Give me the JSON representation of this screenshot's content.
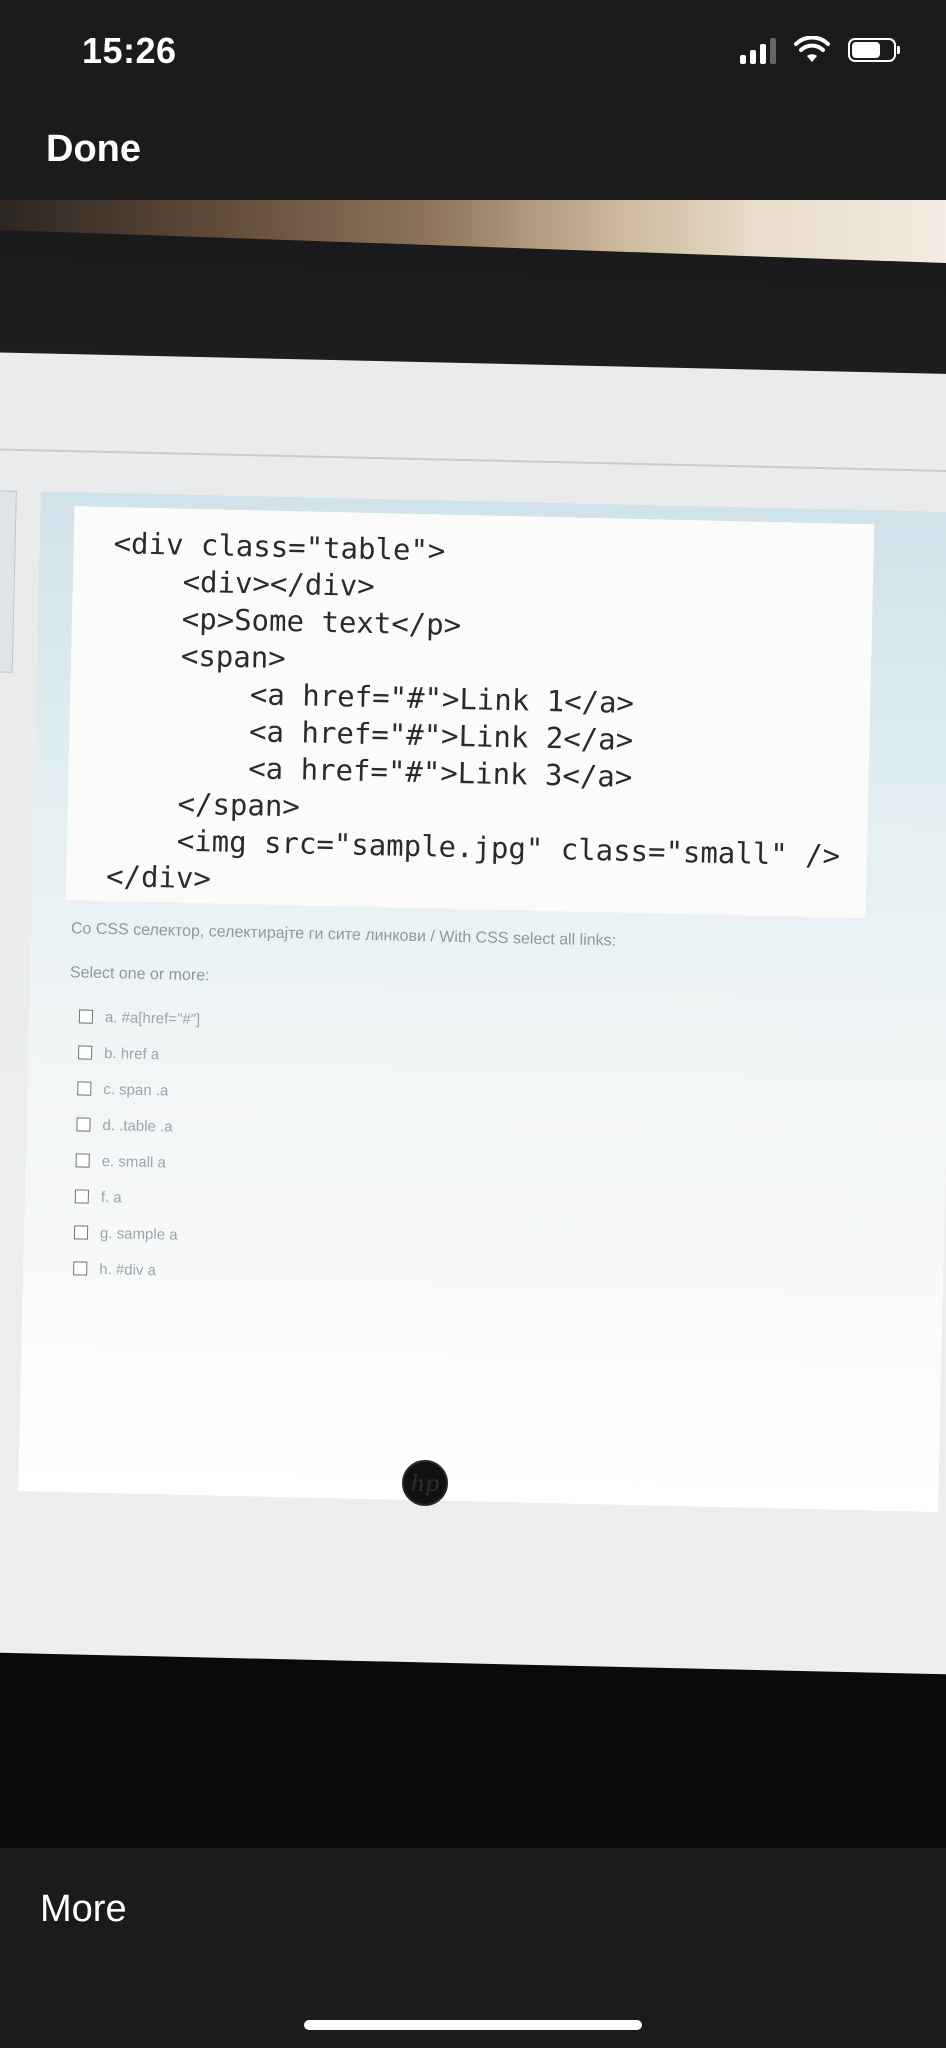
{
  "status_bar": {
    "time": "15:26",
    "battery_level": 0.7
  },
  "nav": {
    "done_label": "Done"
  },
  "photo": {
    "code_lines": [
      "<div class=\"table\">",
      "    <div></div>",
      "    <p>Some text</p>",
      "    <span>",
      "        <a href=\"#\">Link 1</a>",
      "        <a href=\"#\">Link 2</a>",
      "        <a href=\"#\">Link 3</a>",
      "    </span>",
      "    <img src=\"sample.jpg\" class=\"small\" />",
      "</div>"
    ],
    "question": "Со CSS селектор, селектирајте ги сите линкови / With CSS select all links:",
    "select_label": "Select one or more:",
    "options": [
      "a. #a[href=\"#\"]",
      "b. href a",
      "c. span .a",
      "d. .table .a",
      "e. small a",
      "f. a",
      "g. sample a",
      "h. #div a"
    ],
    "logo_text": "hp"
  },
  "bottom": {
    "more_label": "More"
  }
}
